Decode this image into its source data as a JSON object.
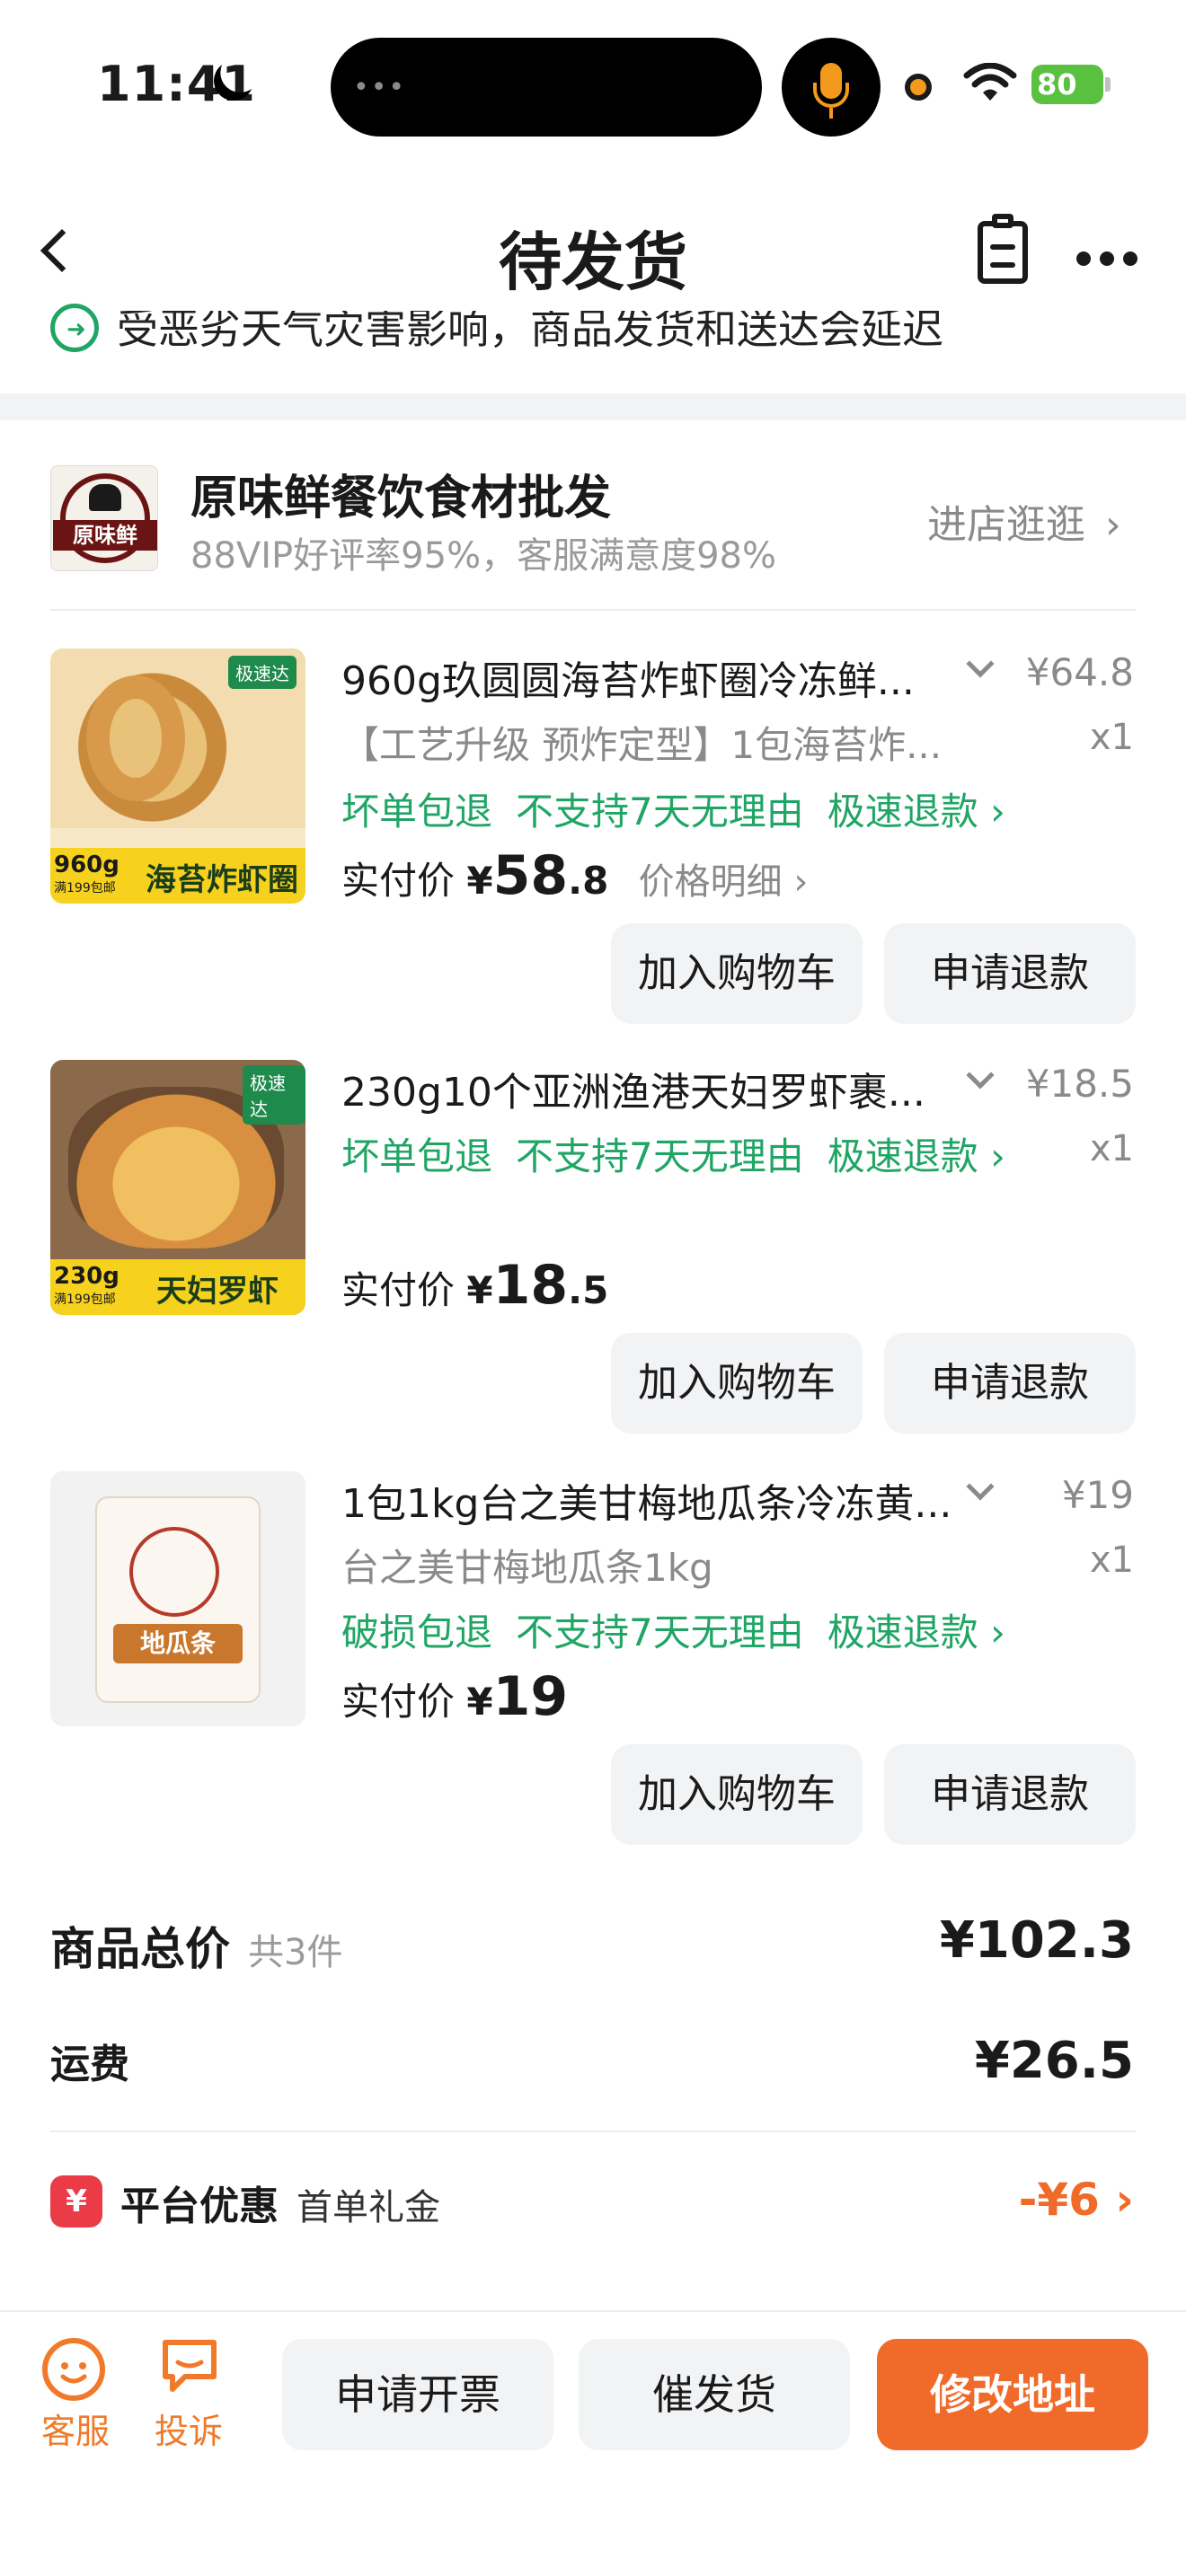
{
  "status_bar": {
    "time": "11:41",
    "battery": "80"
  },
  "nav": {
    "title": "待发货"
  },
  "notice": {
    "text": "受恶劣天气灾害影响，商品发货和送达会延迟"
  },
  "shop": {
    "name": "原味鲜餐饮食材批发",
    "logo_text": "原味鲜",
    "rating": "88VIP好评率95%，客服满意度98%",
    "visit_label": "进店逛逛",
    "visit_arrow": "›"
  },
  "products": [
    {
      "title": "960g玖圆圆海苔炸虾圈冷冻鲜...",
      "price": "¥64.8",
      "spec": "【工艺升级 预炸定型】1包海苔炸...",
      "qty": "x1",
      "tags": [
        "坏单包退",
        "不支持7天无理由",
        "极速退款 ›"
      ],
      "actual_label": "实付价",
      "actual_currency": "¥",
      "actual_int": "58",
      "actual_dec": ".8",
      "detail_label": "价格明细 ›",
      "thumb_badge": "极速达",
      "thumb_weight": "960g",
      "thumb_weight_sub": "满199包邮",
      "thumb_caption": "海苔炸虾圈"
    },
    {
      "title": "230g10个亚洲渔港天妇罗虾裹...",
      "price": "¥18.5",
      "spec": "",
      "qty": "x1",
      "tags": [
        "坏单包退",
        "不支持7天无理由",
        "极速退款 ›"
      ],
      "actual_label": "实付价",
      "actual_currency": "¥",
      "actual_int": "18",
      "actual_dec": ".5",
      "detail_label": "",
      "thumb_badge": "极速达",
      "thumb_weight": "230g",
      "thumb_weight_sub": "满199包邮",
      "thumb_caption": "天妇罗虾"
    },
    {
      "title": "1包1kg台之美甘梅地瓜条冷冻黄...",
      "price": "¥19",
      "spec": "台之美甘梅地瓜条1kg",
      "qty": "x1",
      "tags": [
        "破损包退",
        "不支持7天无理由",
        "极速退款 ›"
      ],
      "actual_label": "实付价",
      "actual_currency": "¥",
      "actual_int": "19",
      "actual_dec": "",
      "detail_label": "",
      "thumb_caption": "地瓜条"
    }
  ],
  "buttons": {
    "add_cart": "加入购物车",
    "refund": "申请退款"
  },
  "summary": {
    "total_label": "商品总价",
    "total_count": "共3件",
    "total_value": "¥102.3",
    "shipping_label": "运费",
    "shipping_value": "¥26.5",
    "promo_label": "平台优惠",
    "promo_sub": "首单礼金",
    "promo_value": "-¥6 ›"
  },
  "bottom_bar": {
    "service": "客服",
    "complain": "投诉",
    "invoice": "申请开票",
    "urge": "催发货",
    "change_address": "修改地址"
  },
  "colors": {
    "accent": "#f06a2a",
    "green": "#20a565",
    "promo_red": "#ea3b47"
  }
}
